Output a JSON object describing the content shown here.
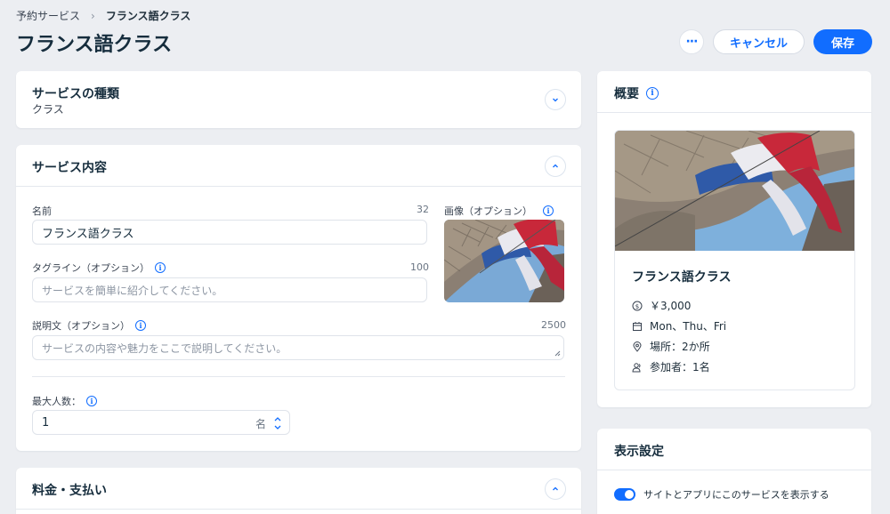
{
  "breadcrumb": {
    "parent": "予約サービス",
    "current": "フランス語クラス"
  },
  "page": {
    "title": "フランス語クラス"
  },
  "actions": {
    "more": "···",
    "cancel": "キャンセル",
    "save": "保存"
  },
  "service_type": {
    "title": "サービスの種類",
    "value": "クラス"
  },
  "service_details": {
    "title": "サービス内容",
    "name": {
      "label": "名前",
      "counter": "32",
      "value": "フランス語クラス"
    },
    "tagline": {
      "label": "タグライン（オプション）",
      "counter": "100",
      "placeholder": "サービスを簡単に紹介してください。"
    },
    "image": {
      "label": "画像（オプション）"
    },
    "description": {
      "label": "説明文（オプション）",
      "counter": "2500",
      "placeholder": "サービスの内容や魅力をここで説明してください。"
    },
    "max_participants": {
      "label": "最大人数：",
      "value": "1",
      "unit": "名"
    }
  },
  "pricing": {
    "title": "料金・支払い"
  },
  "summary": {
    "title": "概要",
    "service_name": "フランス語クラス",
    "price": "￥3,000",
    "days": "Mon、Thu、Fri",
    "location": "場所：2か所",
    "participants": "参加者：1名"
  },
  "display_settings": {
    "title": "表示設定",
    "toggle_label": "サイトとアプリにこのサービスを表示する",
    "toggle_on": true
  },
  "colors": {
    "accent": "#116dff",
    "background": "#eceef2"
  },
  "icons": [
    "chevron-right-icon",
    "info-icon",
    "chevron-down-icon",
    "chevron-up-icon",
    "dollar-icon",
    "calendar-icon",
    "location-pin-icon",
    "people-icon"
  ]
}
